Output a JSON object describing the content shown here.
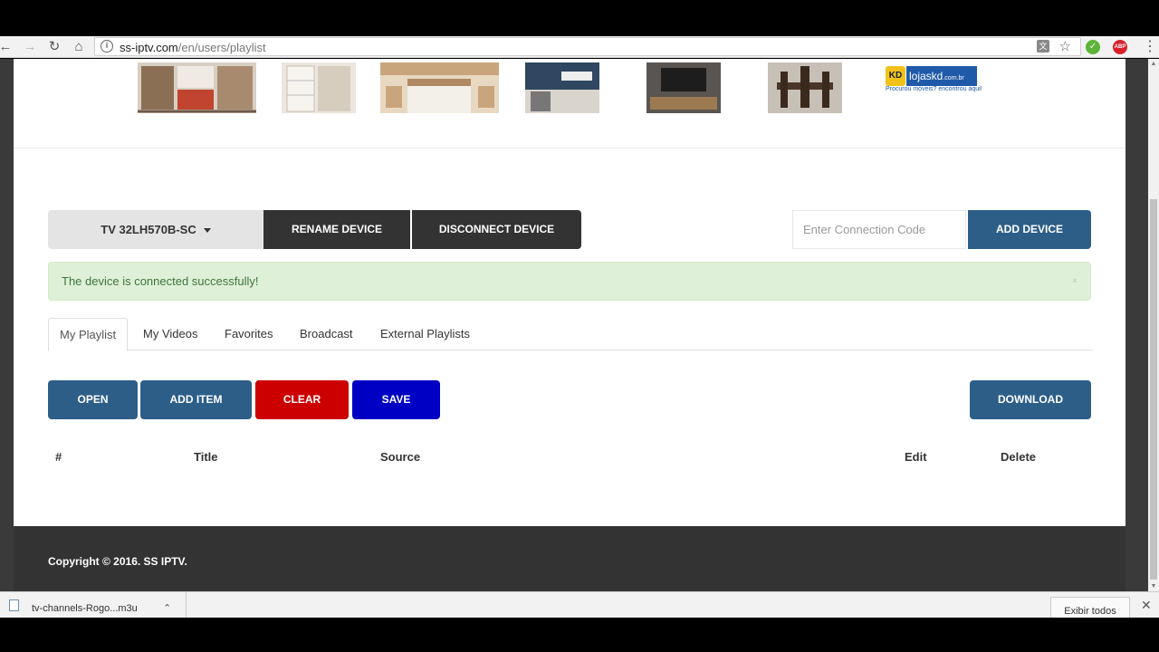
{
  "browser": {
    "url_host": "ss-iptv.com",
    "url_path": "/en/users/playlist"
  },
  "ad": {
    "logo_text": "lojaskd",
    "logo_suffix": ".com.br",
    "logo_badge": "KD",
    "logo_tagline": "Procurou móveis? encontrou aqui!"
  },
  "device": {
    "selected": "TV 32LH570B-SC",
    "rename_label": "RENAME DEVICE",
    "disconnect_label": "DISCONNECT DEVICE",
    "code_placeholder": "Enter Connection Code",
    "add_label": "ADD DEVICE"
  },
  "alert": {
    "message": "The device is connected successfully!"
  },
  "tabs": [
    {
      "label": "My Playlist",
      "active": true
    },
    {
      "label": "My Videos",
      "active": false
    },
    {
      "label": "Favorites",
      "active": false
    },
    {
      "label": "Broadcast",
      "active": false
    },
    {
      "label": "External Playlists",
      "active": false
    }
  ],
  "toolbar": {
    "open_label": "OPEN",
    "add_item_label": "ADD ITEM",
    "clear_label": "CLEAR",
    "save_label": "SAVE",
    "download_label": "DOWNLOAD"
  },
  "table": {
    "columns": [
      "#",
      "Title",
      "Source",
      "Edit",
      "Delete"
    ]
  },
  "footer": {
    "copyright": "Copyright © 2016. SS IPTV."
  },
  "downloads": {
    "item_name": "tv-channels-Rogo...m3u",
    "show_all": "Exibir todos"
  },
  "colors": {
    "primary": "#2c5e88",
    "danger": "#cc0000",
    "save": "#0000c4",
    "dark": "#333333",
    "alert_bg": "#dff0d8"
  }
}
